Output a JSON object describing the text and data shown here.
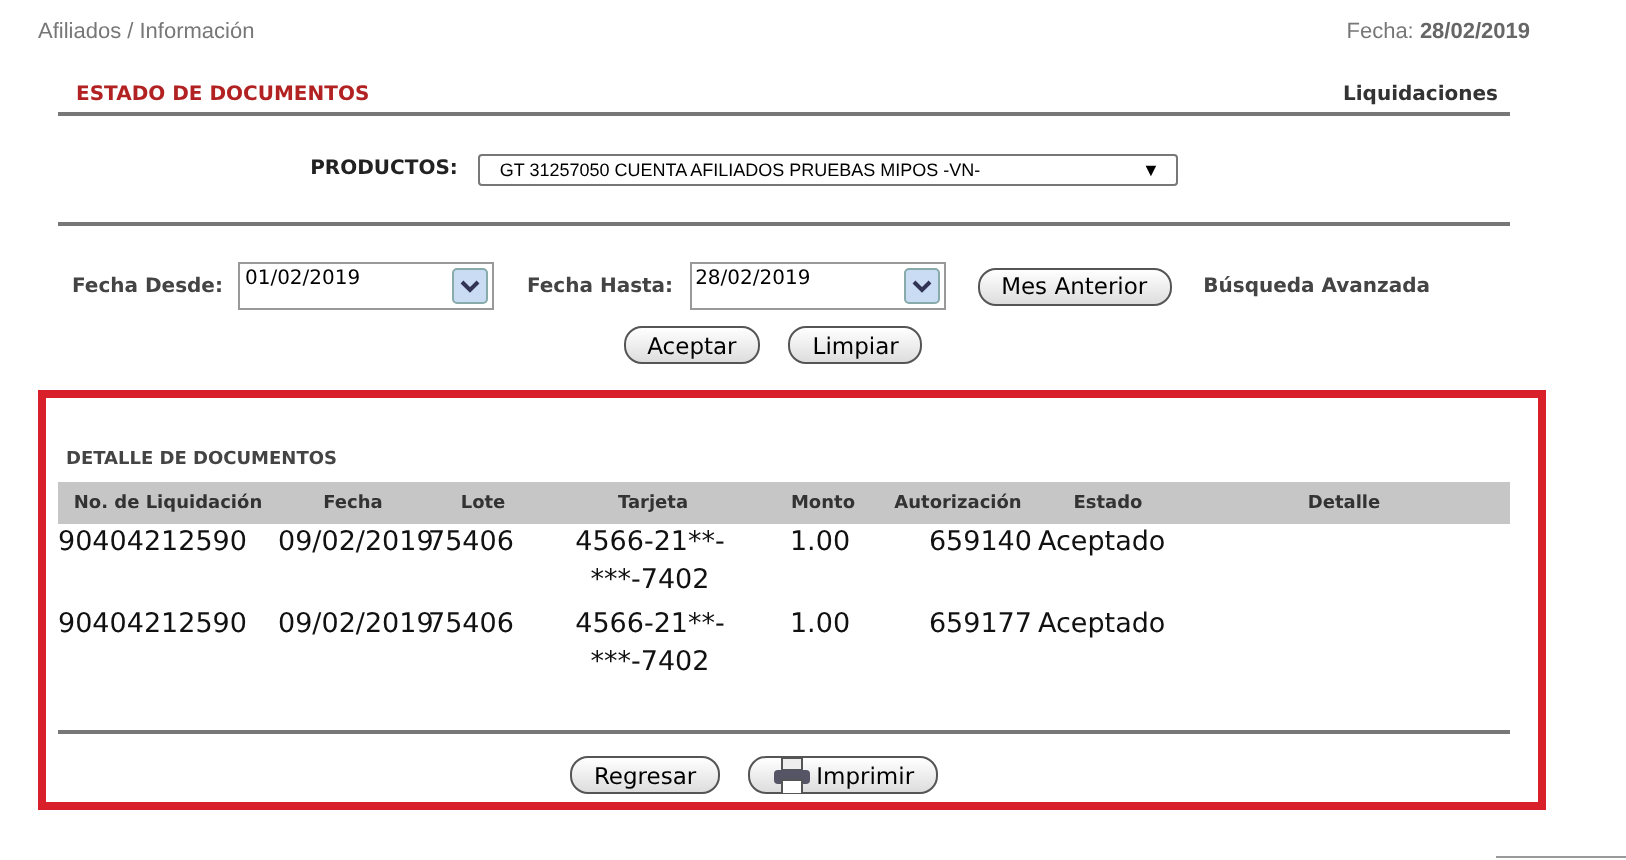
{
  "breadcrumb": "Afiliados / Información",
  "date": {
    "label": "Fecha:",
    "value": "28/02/2019"
  },
  "section": {
    "title": "ESTADO DE DOCUMENTOS",
    "link": "Liquidaciones"
  },
  "products": {
    "label": "PRODUCTOS:",
    "value": "GT 31257050 CUENTA AFILIADOS PRUEBAS MIPOS -VN-",
    "arrow": "▼"
  },
  "filters": {
    "from_label": "Fecha Desde:",
    "from_value": "01/02/2019",
    "to_label": "Fecha Hasta:",
    "to_value": "28/02/2019",
    "prev_button": "Mes Anterior",
    "advanced": "Búsqueda Avanzada"
  },
  "actions": [
    "Aceptar",
    "Limpiar"
  ],
  "detail": {
    "title": "DETALLE DE DOCUMENTOS",
    "columns": [
      "No. de Liquidación",
      "Fecha",
      "Lote",
      "Tarjeta",
      "Monto",
      "Autorización",
      "Estado",
      "Detalle"
    ],
    "rows": [
      [
        "90404212590",
        "09/02/2019",
        "75406",
        "4566-21**-***-7402",
        "1.00",
        "659140",
        "Aceptado",
        ""
      ],
      [
        "90404212590",
        "09/02/2019",
        "75406",
        "4566-21**-***-7402",
        "1.00",
        "659177",
        "Aceptado",
        ""
      ]
    ],
    "buttons": [
      "Regresar",
      "Imprimir"
    ]
  }
}
